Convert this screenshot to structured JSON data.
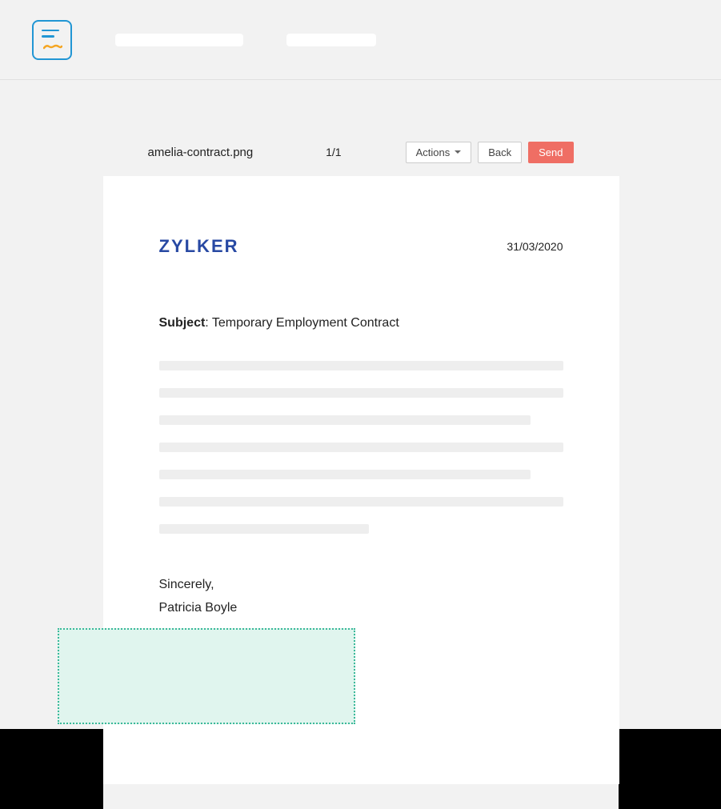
{
  "toolbar": {
    "filename": "amelia-contract.png",
    "page_indicator": "1/1",
    "actions_label": "Actions",
    "back_label": "Back",
    "send_label": "Send"
  },
  "document": {
    "company_name": "ZYLKER",
    "date": "31/03/2020",
    "subject_label": "Subject",
    "subject_value": "Temporary Employment Contract",
    "closing": "Sincerely,",
    "signer_name": "Patricia Boyle"
  }
}
